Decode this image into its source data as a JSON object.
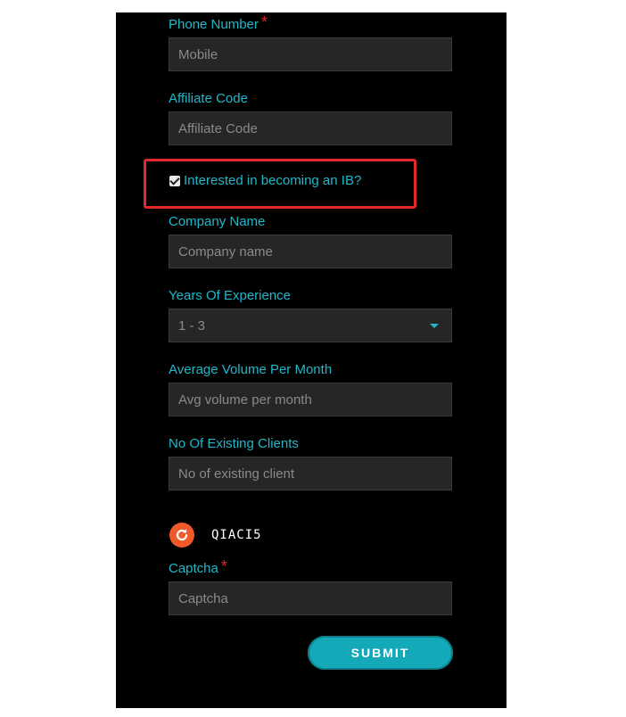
{
  "form": {
    "phone": {
      "label": "Phone Number",
      "required_mark": "*",
      "placeholder": "Mobile"
    },
    "affiliate": {
      "label": "Affiliate Code",
      "placeholder": "Affiliate Code"
    },
    "ib_checkbox": {
      "label": "Interested in becoming an IB?",
      "checked": true
    },
    "company": {
      "label": "Company Name",
      "placeholder": "Company name"
    },
    "experience": {
      "label": "Years Of Experience",
      "selected": "1 - 3"
    },
    "volume": {
      "label": "Average Volume Per Month",
      "placeholder": "Avg volume per month"
    },
    "clients": {
      "label": "No Of Existing Clients",
      "placeholder": "No of existing client"
    },
    "captcha_code": "QIACI5",
    "captcha": {
      "label": "Captcha",
      "required_mark": "*",
      "placeholder": "Captcha"
    },
    "submit_label": "SUBMIT"
  },
  "icons": {
    "refresh": "refresh-icon",
    "dropdown": "chevron-down-icon",
    "checkbox": "check-icon"
  },
  "colors": {
    "panel_bg": "#000000",
    "label": "#1fb8c9",
    "required": "#e0242a",
    "field_bg": "#262626",
    "button": "#13a9b8",
    "refresh": "#f05a28",
    "highlight": "#e3272b"
  }
}
